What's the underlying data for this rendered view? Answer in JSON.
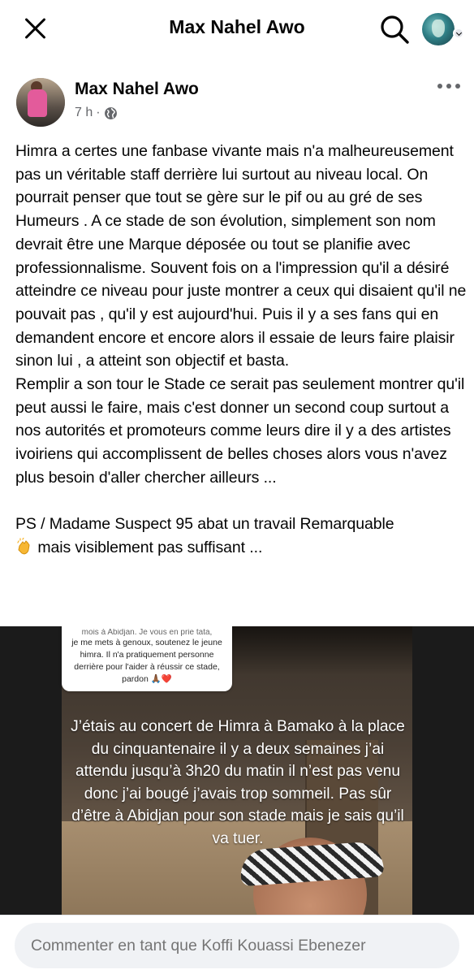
{
  "header": {
    "title": "Max Nahel Awo",
    "close_icon": "close-icon",
    "search_icon": "search-icon",
    "profile_icon": "avatar"
  },
  "post": {
    "author": "Max Nahel Awo",
    "time": "7 h",
    "separator": "·",
    "privacy_icon": "globe-icon",
    "more_icon": "more-icon",
    "text": "Himra a certes une fanbase vivante mais n'a malheureusement pas un véritable staff derrière lui surtout au niveau local. On pourrait penser que tout se gère sur le pif ou au gré de ses Humeurs . A ce stade de son évolution, simplement son nom devrait être une Marque déposée ou tout se planifie avec professionnalisme. Souvent fois on a l'impression qu'il a désiré atteindre ce niveau pour juste montrer a ceux qui disaient qu'il ne pouvait pas , qu'il y est aujourd'hui. Puis il y a ses fans qui en demandent encore et encore alors il essaie de leurs faire plaisir sinon lui , a atteint son objectif et basta.\nRemplir a son tour le Stade ce serait pas seulement montrer qu'il peut aussi le faire, mais c'est donner un second coup surtout a nos autorités et promoteurs comme leurs dire il y a des artistes ivoiriens qui accomplissent de belles choses alors vous n'avez plus besoin d'aller chercher ailleurs ...",
    "ps_line": "PS / Madame Suspect 95 abat un travail Remarquable",
    "ps_end": " mais visiblement pas suffisant ..."
  },
  "media": {
    "comment_cut": "mois à Abidjan. Je vous en prie tata,",
    "comment_text": "je me mets à genoux, soutenez le jeune himra. Il n'a pratiquement personne derrière pour l'aider à réussir ce stade, pardon 🙏🏾❤️",
    "caption": "J’étais au concert de Himra à Bamako à la place du cinquantenaire il y a deux semaines j’ai attendu jusqu’à 3h20 du matin il n’est pas venu donc j’ai bougé j’avais trop sommeil. Pas sûr d’être à Abidjan pour son stade mais je sais qu’il va tuer."
  },
  "comment_bar": {
    "placeholder": "Commenter en tant que Koffi Kouassi Ebenezer"
  }
}
